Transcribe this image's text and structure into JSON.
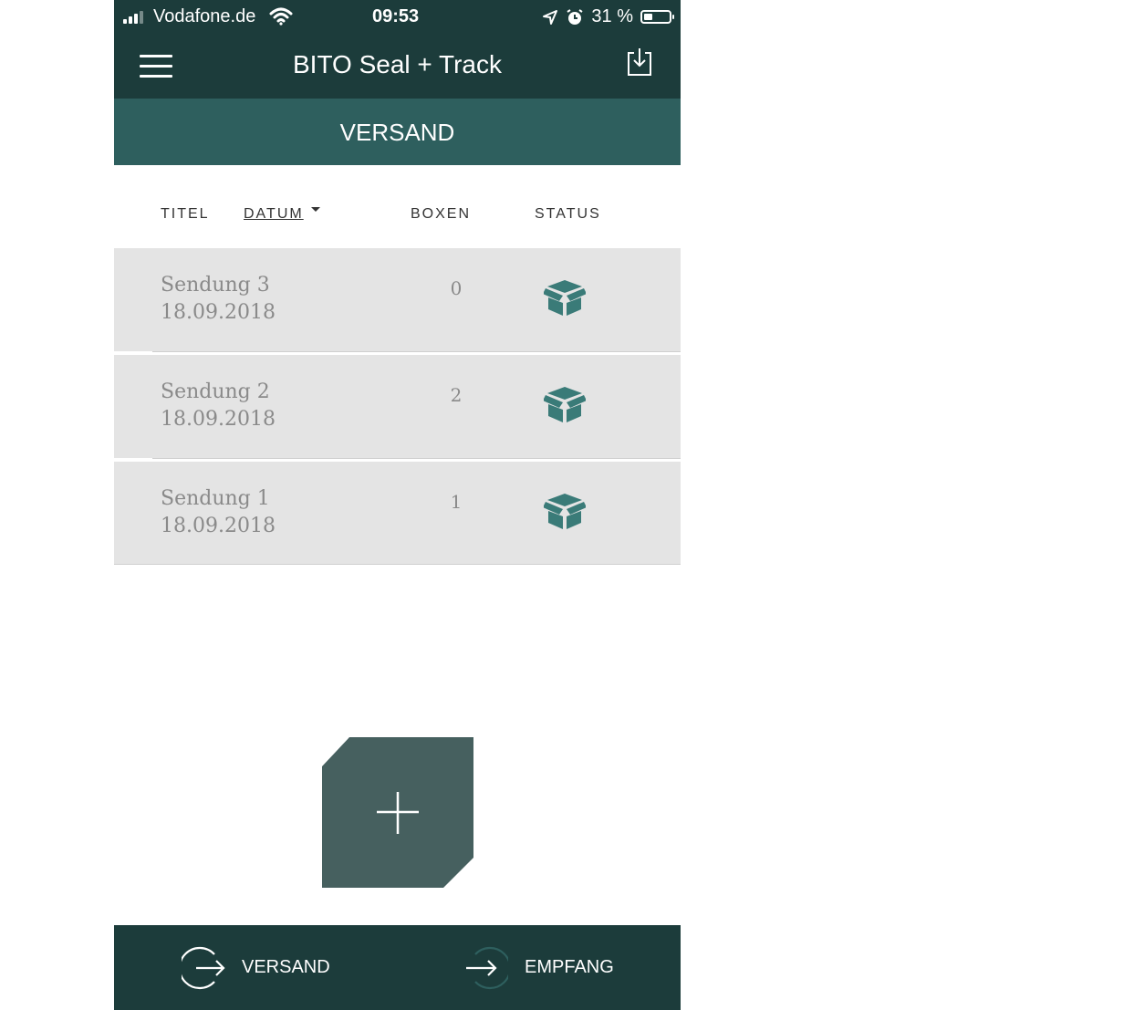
{
  "status_bar": {
    "carrier": "Vodafone.de",
    "time": "09:53",
    "battery_percent": "31 %",
    "battery_level": 0.31
  },
  "header": {
    "title": "BITO Seal + Track",
    "menu_icon": "hamburger-menu-icon",
    "export_icon": "download-tray-icon"
  },
  "section": {
    "title": "VERSAND"
  },
  "table": {
    "columns": {
      "title": "TITEL",
      "date": "DATUM",
      "boxes": "BOXEN",
      "status": "STATUS"
    },
    "sort_column": "DATUM",
    "rows": [
      {
        "title": "Sendung 3",
        "date": "18.09.2018",
        "boxes": "0",
        "status_icon": "open-box-icon"
      },
      {
        "title": "Sendung 2",
        "date": "18.09.2018",
        "boxes": "2",
        "status_icon": "open-box-icon"
      },
      {
        "title": "Sendung 1",
        "date": "18.09.2018",
        "boxes": "1",
        "status_icon": "open-box-icon"
      }
    ]
  },
  "fab": {
    "icon": "plus-icon"
  },
  "bottom_nav": {
    "items": [
      {
        "label": "VERSAND",
        "icon": "send-out-icon"
      },
      {
        "label": "EMPFANG",
        "icon": "receive-in-icon"
      }
    ]
  },
  "colors": {
    "header": "#1c3c3b",
    "section": "#2e5f5e",
    "accent": "#3a7b78",
    "row_bg": "#e4e4e4",
    "fab": "#46605f"
  }
}
